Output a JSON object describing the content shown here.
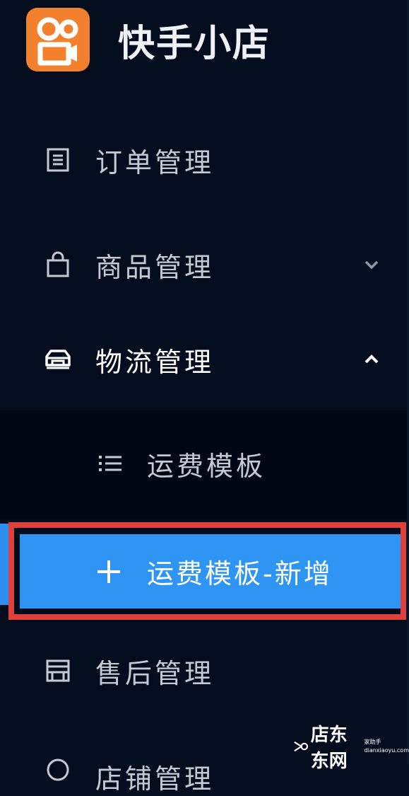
{
  "brand": {
    "title": "快手小店",
    "logo_icon": "kuaishou-logo"
  },
  "nav": {
    "orders": {
      "label": "订单管理",
      "icon": "list-document-icon"
    },
    "goods": {
      "label": "商品管理",
      "icon": "shopping-bag-icon",
      "chevron": "chevron-down-icon"
    },
    "logistics": {
      "label": "物流管理",
      "icon": "truck-icon",
      "chevron": "chevron-up-icon",
      "children": [
        {
          "label": "运费模板",
          "icon": "list-icon"
        },
        {
          "label": "运费模板-新增",
          "icon": "plus-icon",
          "active": true
        }
      ]
    },
    "aftersale": {
      "label": "售后管理",
      "icon": "storefront-icon"
    },
    "cut_item": {
      "label": "店铺管理",
      "icon": "circle-icon"
    }
  },
  "watermark": {
    "text": "店东东网",
    "side_top": "家助手",
    "side_bottom": "dianxiaoyu.com"
  },
  "colors": {
    "background": "#030d1e",
    "active": "#2f95f5",
    "highlight_frame": "#e0403c",
    "logo": "#f2802d"
  }
}
